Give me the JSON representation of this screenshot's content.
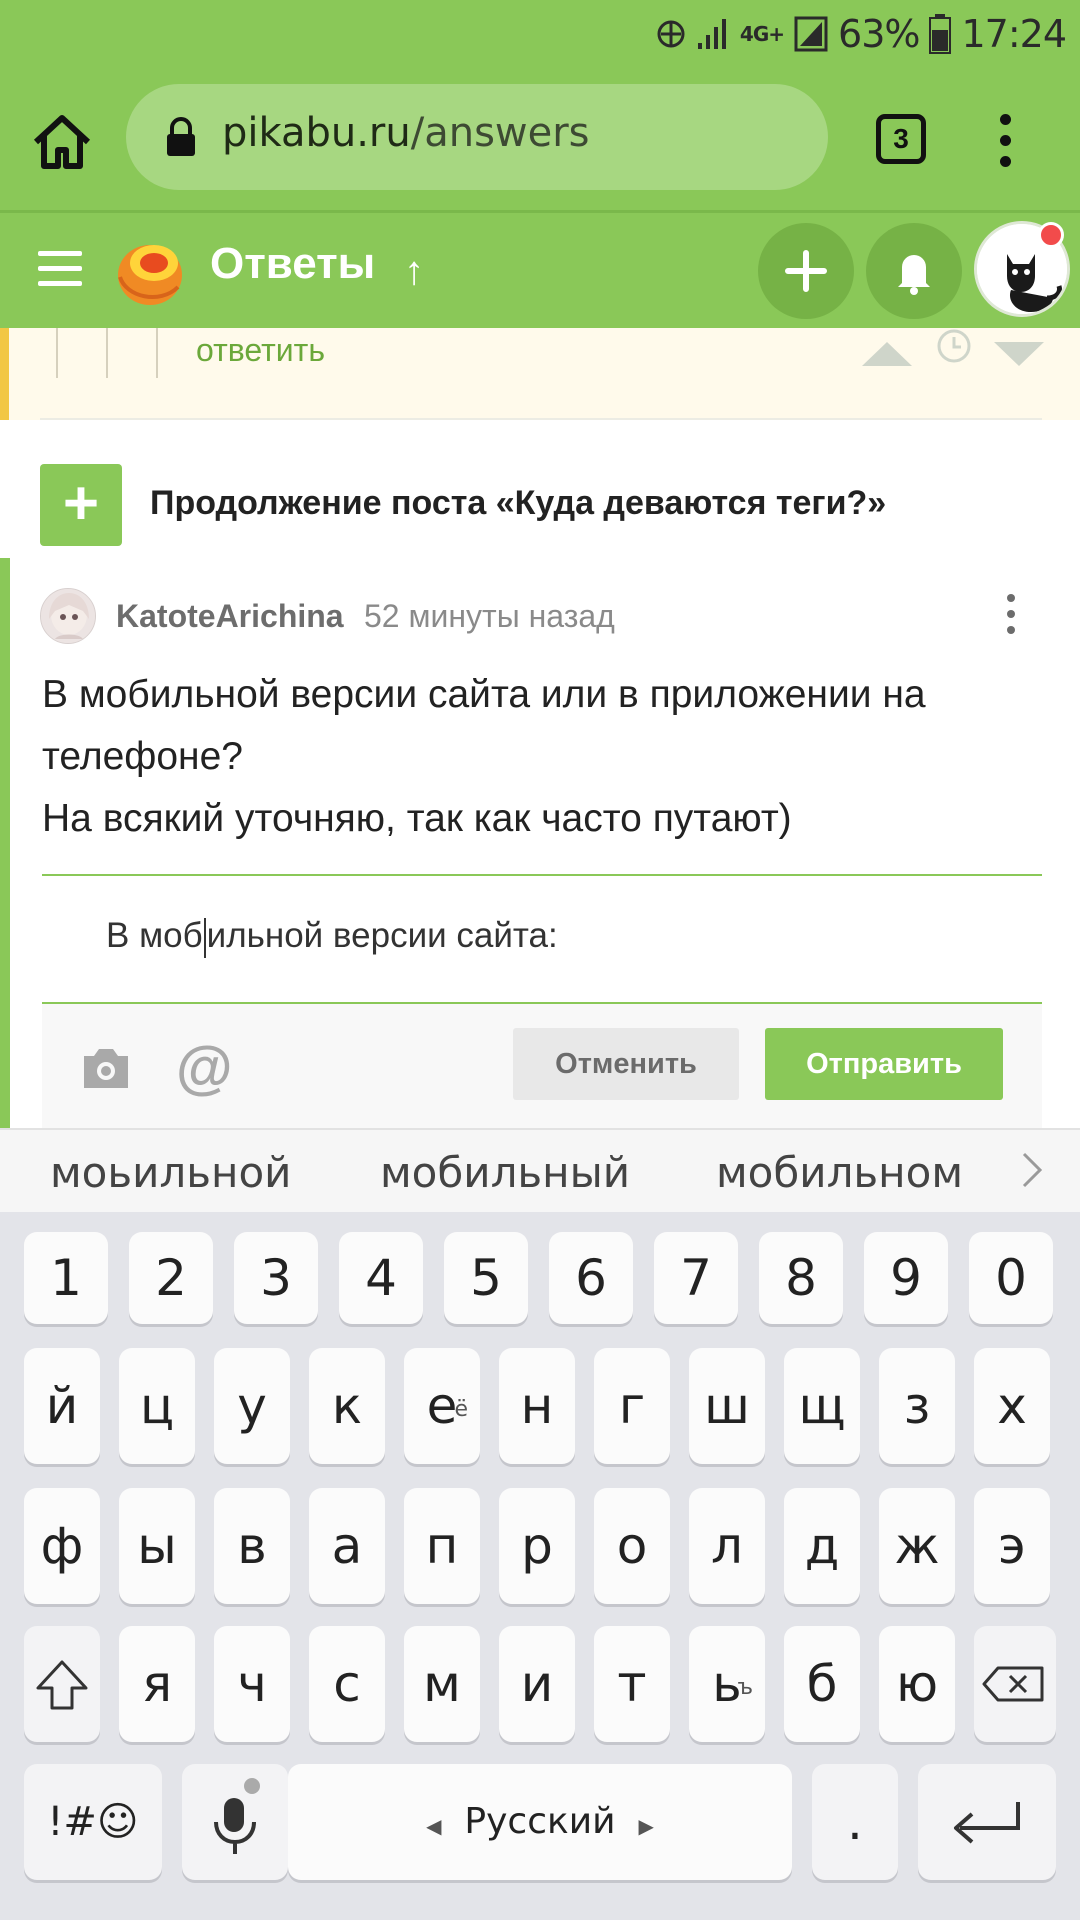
{
  "status_bar": {
    "battery": "63%",
    "time": "17:24",
    "network": "4G+"
  },
  "browser": {
    "url_domain": "pikabu.ru",
    "url_path": "/answers",
    "tab_count": "3"
  },
  "site_header": {
    "title": "Ответы",
    "arrow": "↑"
  },
  "previous_comment": {
    "reply_label": "ответить"
  },
  "continue_post": {
    "label": "Продолжение поста «Куда деваются теги?»"
  },
  "comment": {
    "author": "KatoteArichina",
    "time": "52 минуты назад",
    "body_line1": "В мобильной версии сайта или в приложении на",
    "body_line2": "телефоне?",
    "body_line3": "На всякий уточняю, так как часто путают)"
  },
  "reply_form": {
    "text_before_cursor": "В моб",
    "text_after_cursor": "ильной версии сайта:",
    "cancel_label": "Отменить",
    "send_label": "Отправить"
  },
  "suggestions": [
    "моьильной",
    "мобильный",
    "мобильном"
  ],
  "keyboard": {
    "numbers": [
      "1",
      "2",
      "3",
      "4",
      "5",
      "6",
      "7",
      "8",
      "9",
      "0"
    ],
    "row1": [
      "й",
      "ц",
      "у",
      "к",
      "е",
      "н",
      "г",
      "ш",
      "щ",
      "з",
      "х"
    ],
    "row1_hint_e": "ё",
    "row2": [
      "ф",
      "ы",
      "в",
      "а",
      "п",
      "р",
      "о",
      "л",
      "д",
      "ж",
      "э"
    ],
    "row3": [
      "я",
      "ч",
      "с",
      "м",
      "и",
      "т",
      "ь",
      "б",
      "ю"
    ],
    "row3_hint_soft": "ъ",
    "symbols_label": "!#☺",
    "space_label": "Русский",
    "period_label": "."
  },
  "colors": {
    "brand_green": "#8ac858",
    "accent_yellow": "#f2c744"
  }
}
